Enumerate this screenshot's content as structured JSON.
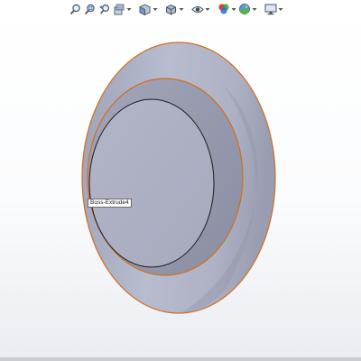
{
  "toolbar": {
    "buttons": [
      {
        "name": "zoom-to-fit",
        "icon": "zoom-to-fit-icon"
      },
      {
        "name": "zoom-to-area",
        "icon": "zoom-to-area-icon"
      },
      {
        "name": "previous-view",
        "icon": "previous-view-icon"
      },
      {
        "name": "section-view",
        "icon": "section-view-icon"
      },
      {
        "name": "view-orientation",
        "icon": "view-orientation-icon"
      },
      {
        "name": "display-style",
        "icon": "display-style-icon"
      },
      {
        "name": "hide-show-items",
        "icon": "eye-icon"
      },
      {
        "name": "edit-appearance",
        "icon": "appearance-icon"
      },
      {
        "name": "apply-scene",
        "icon": "scene-icon"
      },
      {
        "name": "view-settings",
        "icon": "monitor-icon"
      }
    ]
  },
  "viewport": {
    "feature_label": "Boss-Extrude4",
    "colors": {
      "part_face": "#a8abc0",
      "edge_highlight": "#d06e1c",
      "silhouette_edge": "#1b1b1b",
      "background": "#ffffff"
    }
  }
}
